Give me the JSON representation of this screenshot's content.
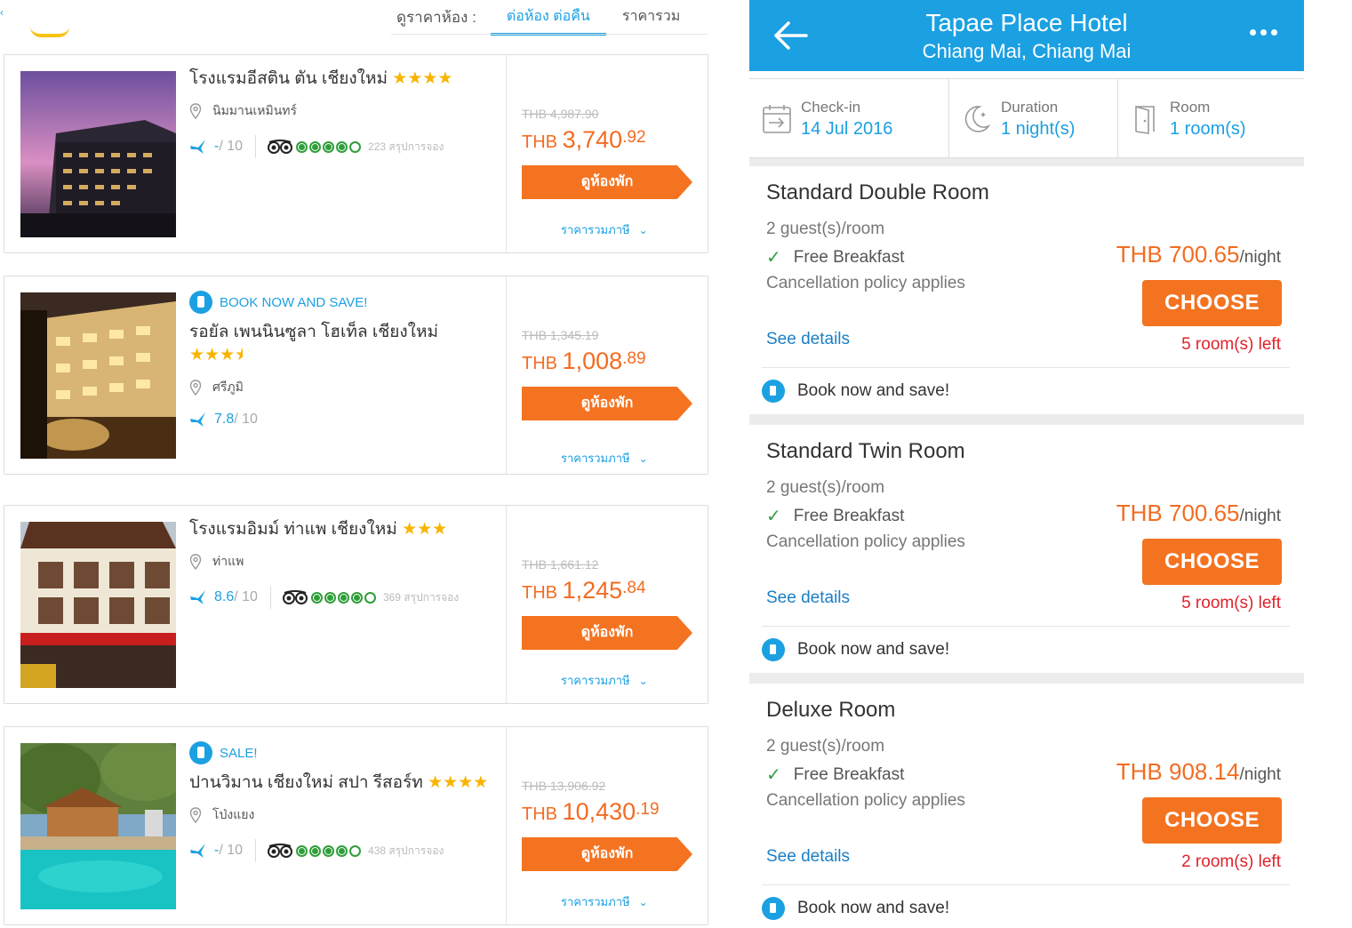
{
  "left": {
    "sort_label": "ดูราคาห้อง :",
    "sort_tabs": [
      "ต่อห้อง ต่อคืน",
      "ราคารวม"
    ],
    "hotels": [
      {
        "name": "โรงแรมอีสติน ตัน เชียงใหม่",
        "stars": "★★★★",
        "promo": "",
        "location": "นิมมานเหมินทร์",
        "score": "-",
        "score_max": " / 10",
        "tripadvisor_reviews": "223 สรุปการจอง",
        "old_price": "THB 4,987.90",
        "currency": "THB ",
        "price_main": "3,740",
        "price_cents": ".92",
        "button": "ดูห้องพัก",
        "tax_link": "ราคารวมภาษี"
      },
      {
        "name": "รอยัล เพนนินซูลา โฮเท็ล เชียงใหม่",
        "stars": "★★★",
        "promo": "BOOK NOW AND SAVE!",
        "location": "ศรีภูมิ",
        "score": "7.8",
        "score_max": " / 10",
        "tripadvisor_reviews": "",
        "old_price": "THB 1,345.19",
        "currency": "THB ",
        "price_main": "1,008",
        "price_cents": ".89",
        "button": "ดูห้องพัก",
        "tax_link": "ราคารวมภาษี"
      },
      {
        "name": "โรงแรมอิมม์ ท่าแพ เชียงใหม่",
        "stars": "★★★",
        "promo": "",
        "location": "ท่าแพ",
        "score": "8.6",
        "score_max": " / 10",
        "tripadvisor_reviews": "369 สรุปการจอง",
        "old_price": "THB 1,661.12",
        "currency": "THB ",
        "price_main": "1,245",
        "price_cents": ".84",
        "button": "ดูห้องพัก",
        "tax_link": "ราคารวมภาษี"
      },
      {
        "name": "ปานวิมาน เชียงใหม่ สปา รีสอร์ท",
        "stars": "★★★★",
        "promo": "SALE!",
        "location": "โป่งแยง",
        "score": "-",
        "score_max": " / 10",
        "tripadvisor_reviews": "438 สรุปการจอง",
        "old_price": "THB 13,906.92",
        "currency": "THB ",
        "price_main": "10,430",
        "price_cents": ".19",
        "button": "ดูห้องพัก",
        "tax_link": "ราคารวมภาษี"
      }
    ]
  },
  "right": {
    "title": "Tapae Place Hotel",
    "subtitle": "Chiang Mai, Chiang Mai",
    "checkin_label": "Check-in",
    "checkin_value": "14 Jul 2016",
    "duration_label": "Duration",
    "duration_value": "1 night(s)",
    "room_label": "Room",
    "room_value": "1 room(s)",
    "rooms": [
      {
        "name": "Standard Double Room",
        "guests": "2 guest(s)/room",
        "breakfast": "Free Breakfast",
        "policy": "Cancellation policy applies",
        "details": "See details",
        "price": "THB 700.65",
        "unit": "/night",
        "button": "CHOOSE",
        "left": "5 room(s) left",
        "save": "Book now and save!"
      },
      {
        "name": "Standard Twin Room",
        "guests": "2 guest(s)/room",
        "breakfast": "Free Breakfast",
        "policy": "Cancellation policy applies",
        "details": "See details",
        "price": "THB 700.65",
        "unit": "/night",
        "button": "CHOOSE",
        "left": "5 room(s) left",
        "save": "Book now and save!"
      },
      {
        "name": "Deluxe Room",
        "guests": "2 guest(s)/room",
        "breakfast": "Free Breakfast",
        "policy": "Cancellation policy applies",
        "details": "See details",
        "price": "THB 908.14",
        "unit": "/night",
        "button": "CHOOSE",
        "left": "2 room(s) left",
        "save": "Book now and save!"
      }
    ]
  },
  "colors": {
    "accent_blue": "#1ba0e2",
    "price_orange": "#f36c21",
    "button_orange": "#f47320",
    "alert_red": "#e0222a",
    "tripadvisor_green": "#2f9e3a"
  }
}
